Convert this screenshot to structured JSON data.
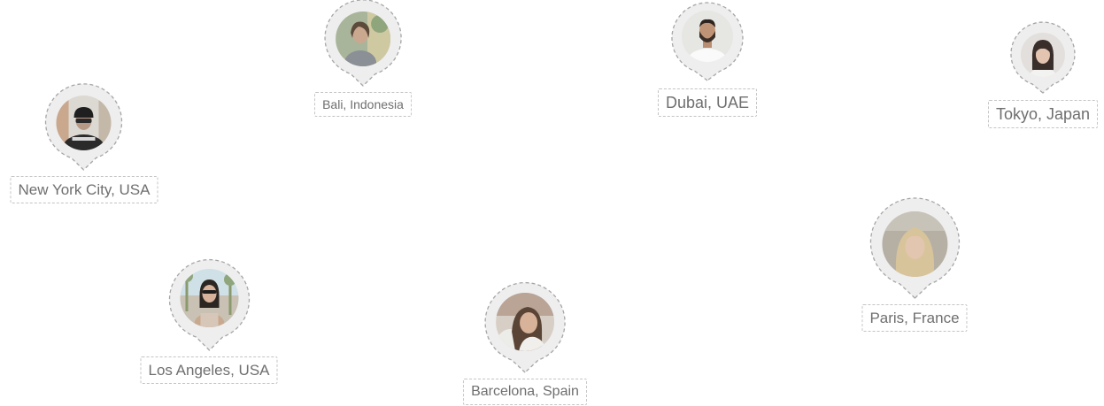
{
  "locations": [
    {
      "id": "bali",
      "label": "Bali, Indonesia",
      "avatar": "avatar-woman-outdoor"
    },
    {
      "id": "dubai",
      "label": "Dubai, UAE",
      "avatar": "avatar-man-beard"
    },
    {
      "id": "tokyo",
      "label": "Tokyo, Japan",
      "avatar": "avatar-woman-dark-hair"
    },
    {
      "id": "new-york",
      "label": "New York City, USA",
      "avatar": "avatar-man-cap"
    },
    {
      "id": "paris",
      "label": "Paris, France",
      "avatar": "avatar-woman-blonde"
    },
    {
      "id": "los-angeles",
      "label": "Los Angeles, USA",
      "avatar": "avatar-woman-sunglasses"
    },
    {
      "id": "barcelona",
      "label": "Barcelona, Spain",
      "avatar": "avatar-woman-smiling"
    }
  ],
  "colors": {
    "pin_fill": "#eeeeee",
    "pin_dash": "#a6a6a6",
    "label_border": "#c4c4c4",
    "label_text": "#6f6f6f"
  }
}
